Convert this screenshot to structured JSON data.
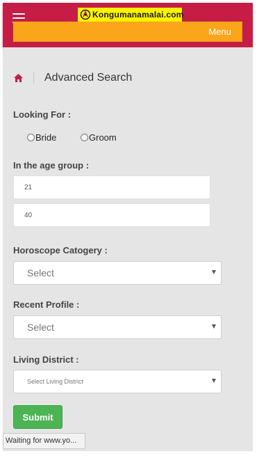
{
  "header": {
    "brand": "Kongumanamalai.com",
    "menu_label": "Menu",
    "colors": {
      "topbar": "#c51d45",
      "menubar": "#fba51a",
      "logo_bg": "#fff200"
    }
  },
  "breadcrumb": {
    "home_icon": "home-icon",
    "title": "Advanced Search"
  },
  "form": {
    "looking_for": {
      "label": "Looking For :",
      "options": [
        "Bride",
        "Groom"
      ]
    },
    "age_group": {
      "label": "In the age group :",
      "from": "21",
      "to": "40"
    },
    "horoscope": {
      "label": "Horoscope Catogery :",
      "selected": "Select"
    },
    "recent_profile": {
      "label": "Recent Profile :",
      "selected": "Select"
    },
    "living_district": {
      "label": "Living District :",
      "selected": "Select Living District"
    },
    "submit_label": "Submit"
  },
  "status_bar": {
    "text": "Waiting for www.yo..."
  }
}
